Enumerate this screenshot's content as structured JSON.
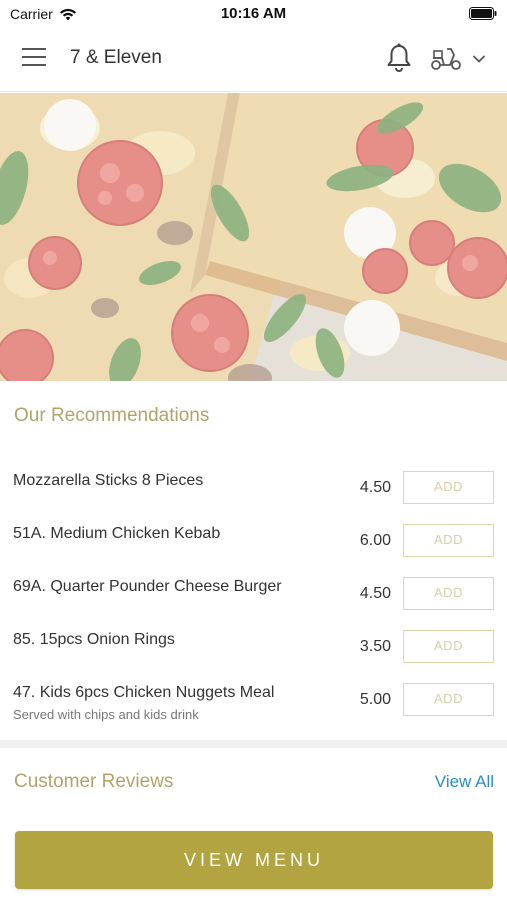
{
  "status_bar": {
    "carrier": "Carrier",
    "time": "10:16 AM"
  },
  "header": {
    "title": "7 & Eleven",
    "icons": [
      "menu-icon",
      "bell-icon",
      "scooter-icon",
      "chevron-down-icon"
    ]
  },
  "hero": {
    "image": "pizza-photo"
  },
  "recommendations": {
    "title": "Our Recommendations",
    "items": [
      {
        "name": "Mozzarella Sticks 8 Pieces",
        "description": "",
        "price": "4.50",
        "add_label": "ADD"
      },
      {
        "name": "51A. Medium Chicken Kebab",
        "description": "",
        "price": "6.00",
        "add_label": "ADD"
      },
      {
        "name": "69A. Quarter Pounder Cheese Burger",
        "description": "",
        "price": "4.50",
        "add_label": "ADD"
      },
      {
        "name": "85. 15pcs Onion Rings",
        "description": "",
        "price": "3.50",
        "add_label": "ADD"
      },
      {
        "name": "47. Kids 6pcs Chicken Nuggets Meal",
        "description": "Served with chips and kids drink",
        "price": "5.00",
        "add_label": "ADD"
      }
    ]
  },
  "reviews": {
    "title": "Customer Reviews",
    "view_all": "View All"
  },
  "footer": {
    "view_menu": "VIEW MENU"
  },
  "colors": {
    "accent_gold": "#b3a442",
    "section_title": "#b3a36a",
    "link_blue": "#2a8fc4",
    "add_border": "#e1d7ae"
  }
}
